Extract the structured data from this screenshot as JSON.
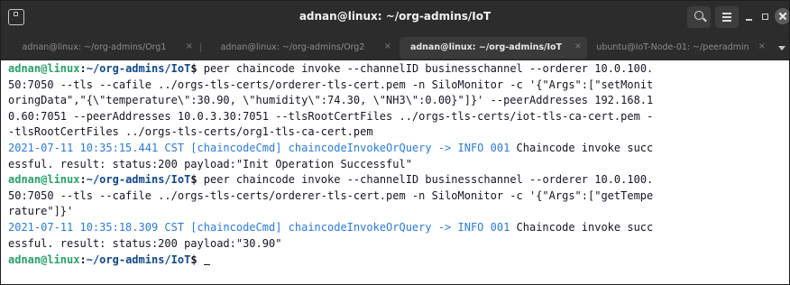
{
  "window": {
    "title": "adnan@linux: ~/org-admins/IoT"
  },
  "tabs": [
    {
      "label": "adnan@linux: ~/org-admins/Org1",
      "close": "×",
      "active": false
    },
    {
      "label": "adnan@linux: ~/org-admins/Org2",
      "close": "×",
      "active": false
    },
    {
      "label": "adnan@linux: ~/org-admins/IoT",
      "close": "×",
      "active": true
    },
    {
      "label": "ubuntu@IoT-Node-01: ~/peeradmin",
      "close": "×",
      "active": false
    }
  ],
  "prompt": {
    "user": "adnan@linux",
    "sep": ":",
    "path": "~/org-admins/IoT",
    "symbol": "$ "
  },
  "terminal": {
    "lines": [
      {
        "kind": "prompt",
        "text": "peer chaincode invoke --channelID businesschannel --orderer 10.0.100."
      },
      {
        "kind": "plain",
        "text": "50:7050 --tls --cafile ../orgs-tls-certs/orderer-tls-cert.pem -n SiloMonitor -c '{\"Args\":[\"setMonit"
      },
      {
        "kind": "plain",
        "text": "oringData\",\"{\\\"temperature\\\":30.90, \\\"humidity\\\":74.30, \\\"NH3\\\":0.00}\"]}' --peerAddresses 192.168.1"
      },
      {
        "kind": "plain",
        "text": "0.60:7051 --peerAddresses 10.0.3.30:7051 --tlsRootCertFiles ../orgs-tls-certs/iot-tls-ca-cert.pem -"
      },
      {
        "kind": "plain",
        "text": "-tlsRootCertFiles ../orgs-tls-certs/org1-tls-ca-cert.pem"
      },
      {
        "kind": "log",
        "log": "2021-07-11 10:35:15.441 CST [chaincodeCmd] chaincodeInvokeOrQuery -> INFO 001",
        "text": " Chaincode invoke succ"
      },
      {
        "kind": "plain",
        "text": "essful. result: status:200 payload:\"Init Operation Successful\""
      },
      {
        "kind": "prompt",
        "text": "peer chaincode invoke --channelID businesschannel --orderer 10.0.100."
      },
      {
        "kind": "plain",
        "text": "50:7050 --tls --cafile ../orgs-tls-certs/orderer-tls-cert.pem -n SiloMonitor -c '{\"Args\":[\"getTempe"
      },
      {
        "kind": "plain",
        "text": "rature\"]}'"
      },
      {
        "kind": "log",
        "log": "2021-07-11 10:35:18.309 CST [chaincodeCmd] chaincodeInvokeOrQuery -> INFO 001",
        "text": " Chaincode invoke succ"
      },
      {
        "kind": "plain",
        "text": "essful. result: status:200 payload:\"30.90\""
      },
      {
        "kind": "prompt",
        "text": ""
      }
    ]
  },
  "colors": {
    "user": "#26a269",
    "path": "#12488b",
    "log": "#2a7bde",
    "text": "#171421",
    "titlebar": "#2c2c2c"
  }
}
